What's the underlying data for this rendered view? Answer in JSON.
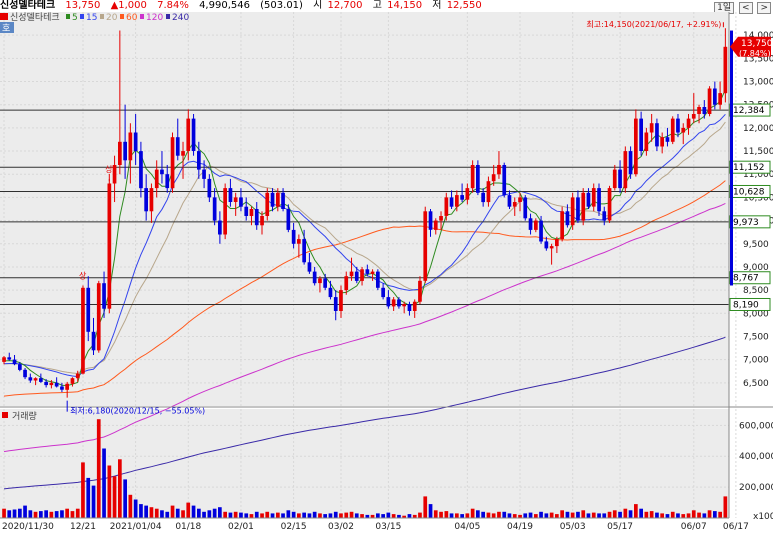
{
  "header": {
    "name": "신성델타테크",
    "price": "13,750",
    "change": "▲1,000",
    "rate": "7.84%",
    "volume": "4,990,546",
    "volume_paren": "(503.01)",
    "open_label": "시",
    "open": "12,700",
    "high_label": "고",
    "high": "14,150",
    "low_label": "저",
    "low": "12,550",
    "period_btn": "1일",
    "nav_prev": "<",
    "nav_next": ">"
  },
  "colors": {
    "up": "#e60000",
    "down": "#0000dd",
    "ma5": "#2e8b20",
    "ma15": "#3344ee",
    "ma20": "#b8a78c",
    "ma60": "#ff5a1e",
    "ma120": "#cc33cc",
    "ma240": "#3a2aa8",
    "grid": "#d8d8d8",
    "hline": "#303030"
  },
  "chart_data": {
    "type": "candlestick",
    "legend": {
      "name": "신성델타테크",
      "items": [
        "5",
        "15",
        "20",
        "60",
        "120",
        "240"
      ],
      "tag": "호"
    },
    "price_axis": {
      "min": 6000,
      "max": 14500,
      "ticks": [
        "14,000",
        "13,500",
        "13,000",
        "12,500",
        "12,000",
        "11,500",
        "11,000",
        "10,500",
        "10,000",
        "9,500",
        "9,000",
        "8,500",
        "8,000",
        "7,500",
        "7,000",
        "6,500"
      ]
    },
    "volume_axis": {
      "max": 680000,
      "ticks": [
        "600,000",
        "400,000",
        "200,000",
        "x100"
      ]
    },
    "volume_label": "거래량",
    "x_labels": [
      {
        "label": "2020/11/30",
        "i": 0
      },
      {
        "label": "12/21",
        "i": 15
      },
      {
        "label": "2021/01/04",
        "i": 25
      },
      {
        "label": "01/18",
        "i": 35
      },
      {
        "label": "02/01",
        "i": 45
      },
      {
        "label": "02/15",
        "i": 55
      },
      {
        "label": "03/02",
        "i": 64
      },
      {
        "label": "03/15",
        "i": 73
      },
      {
        "label": "04/05",
        "i": 88
      },
      {
        "label": "04/19",
        "i": 98
      },
      {
        "label": "05/03",
        "i": 108
      },
      {
        "label": "05/17",
        "i": 117
      },
      {
        "label": "06/07",
        "i": 131
      },
      {
        "label": "06/17",
        "i": 139
      }
    ],
    "support_lines": [
      "12,384",
      "11,152",
      "10,628",
      "9,973",
      "8,767",
      "8,190"
    ],
    "current_price": {
      "price": "13,750",
      "rate": "(7.84%)"
    },
    "annotations": {
      "high": "최고:14,150(2021/06/17, +2.91%)",
      "low": "최저:6,180(2020/12/15, −55.05%)",
      "marker_upper": "상",
      "marker_lower": "상"
    },
    "candles": [
      [
        6950,
        7080,
        6900,
        7050,
        60000
      ],
      [
        7050,
        7150,
        6980,
        7000,
        50000
      ],
      [
        7000,
        7100,
        6880,
        6900,
        55000
      ],
      [
        6900,
        6950,
        6750,
        6780,
        60000
      ],
      [
        6780,
        6820,
        6580,
        6620,
        80000
      ],
      [
        6620,
        6700,
        6500,
        6550,
        50000
      ],
      [
        6550,
        6620,
        6450,
        6600,
        40000
      ],
      [
        6600,
        6700,
        6500,
        6520,
        45000
      ],
      [
        6520,
        6580,
        6400,
        6450,
        50000
      ],
      [
        6450,
        6560,
        6380,
        6500,
        40000
      ],
      [
        6500,
        6620,
        6400,
        6420,
        45000
      ],
      [
        6420,
        6500,
        6300,
        6350,
        50000
      ],
      [
        6350,
        6520,
        6180,
        6480,
        60000
      ],
      [
        6480,
        6620,
        6420,
        6600,
        45000
      ],
      [
        6600,
        6760,
        6520,
        6700,
        60000
      ],
      [
        6700,
        8600,
        6680,
        8550,
        360000
      ],
      [
        8550,
        8800,
        7400,
        7600,
        260000
      ],
      [
        7600,
        7900,
        7100,
        7200,
        210000
      ],
      [
        7200,
        8700,
        7150,
        8650,
        640000
      ],
      [
        8650,
        8900,
        7900,
        8100,
        450000
      ],
      [
        8100,
        10900,
        8000,
        10800,
        340000
      ],
      [
        10800,
        11400,
        10400,
        11200,
        270000
      ],
      [
        11200,
        14100,
        11000,
        11700,
        380000
      ],
      [
        11700,
        12500,
        10900,
        11300,
        250000
      ],
      [
        11300,
        12100,
        10800,
        11900,
        150000
      ],
      [
        11900,
        12300,
        11200,
        11500,
        120000
      ],
      [
        11500,
        11700,
        10500,
        10700,
        90000
      ],
      [
        10700,
        11000,
        10000,
        10200,
        80000
      ],
      [
        10200,
        10800,
        9950,
        10700,
        70000
      ],
      [
        10700,
        11300,
        10500,
        11100,
        60000
      ],
      [
        11100,
        11500,
        10800,
        11000,
        50000
      ],
      [
        11000,
        11200,
        10600,
        10700,
        40000
      ],
      [
        10700,
        11900,
        10600,
        11800,
        80000
      ],
      [
        11800,
        12200,
        11300,
        11400,
        60000
      ],
      [
        11400,
        11700,
        10900,
        11500,
        50000
      ],
      [
        11500,
        12400,
        11300,
        12200,
        100000
      ],
      [
        12200,
        12300,
        11400,
        11500,
        80000
      ],
      [
        11500,
        11700,
        10900,
        11100,
        60000
      ],
      [
        11100,
        11300,
        10700,
        10900,
        40000
      ],
      [
        10900,
        11000,
        10400,
        10500,
        50000
      ],
      [
        10500,
        10700,
        9900,
        10000,
        60000
      ],
      [
        10000,
        10200,
        9500,
        9700,
        70000
      ],
      [
        9700,
        10800,
        9600,
        10700,
        40000
      ],
      [
        10700,
        10900,
        10300,
        10400,
        35000
      ],
      [
        10400,
        10600,
        10100,
        10500,
        40000
      ],
      [
        10500,
        10700,
        10200,
        10300,
        35000
      ],
      [
        10300,
        10500,
        10000,
        10100,
        30000
      ],
      [
        10100,
        10300,
        9900,
        10250,
        25000
      ],
      [
        10250,
        10400,
        9800,
        9900,
        40000
      ],
      [
        9900,
        10200,
        9700,
        10100,
        30000
      ],
      [
        10100,
        10700,
        10000,
        10600,
        40000
      ],
      [
        10600,
        10700,
        10200,
        10300,
        30000
      ],
      [
        10300,
        10700,
        10200,
        10600,
        35000
      ],
      [
        10600,
        10700,
        10200,
        10250,
        30000
      ],
      [
        10250,
        10350,
        9750,
        9800,
        50000
      ],
      [
        9800,
        9950,
        9400,
        9500,
        40000
      ],
      [
        9500,
        9700,
        9200,
        9600,
        30000
      ],
      [
        9600,
        9800,
        9050,
        9100,
        35000
      ],
      [
        9100,
        9300,
        8850,
        8900,
        30000
      ],
      [
        8900,
        9000,
        8600,
        8650,
        40000
      ],
      [
        8650,
        8800,
        8450,
        8750,
        30000
      ],
      [
        8750,
        8850,
        8500,
        8550,
        25000
      ],
      [
        8550,
        8700,
        8300,
        8350,
        30000
      ],
      [
        8350,
        8500,
        7850,
        8050,
        40000
      ],
      [
        8050,
        8600,
        7900,
        8500,
        30000
      ],
      [
        8500,
        8900,
        8400,
        8800,
        35000
      ],
      [
        8800,
        9200,
        8700,
        8900,
        40000
      ],
      [
        8900,
        9000,
        8650,
        8700,
        30000
      ],
      [
        8700,
        9000,
        8600,
        8950,
        25000
      ],
      [
        8950,
        9050,
        8800,
        8850,
        20000
      ],
      [
        8850,
        8950,
        8700,
        8900,
        20000
      ],
      [
        8900,
        8950,
        8500,
        8550,
        30000
      ],
      [
        8550,
        8650,
        8300,
        8350,
        25000
      ],
      [
        8350,
        8500,
        8100,
        8150,
        35000
      ],
      [
        8150,
        8350,
        8050,
        8300,
        25000
      ],
      [
        8300,
        8350,
        8100,
        8150,
        20000
      ],
      [
        8150,
        8250,
        8000,
        8200,
        15000
      ],
      [
        8200,
        8250,
        7950,
        8050,
        25000
      ],
      [
        8050,
        8300,
        7900,
        8250,
        20000
      ],
      [
        8250,
        8800,
        8200,
        8700,
        35000
      ],
      [
        8700,
        10300,
        8650,
        10200,
        140000
      ],
      [
        10200,
        10250,
        9650,
        9800,
        90000
      ],
      [
        9800,
        10050,
        9700,
        10000,
        50000
      ],
      [
        10000,
        10200,
        9800,
        10100,
        40000
      ],
      [
        10100,
        10600,
        10000,
        10500,
        45000
      ],
      [
        10500,
        10650,
        10250,
        10300,
        30000
      ],
      [
        10300,
        10650,
        10200,
        10550,
        30000
      ],
      [
        10550,
        10800,
        10400,
        10450,
        25000
      ],
      [
        10450,
        10800,
        10350,
        10700,
        30000
      ],
      [
        10700,
        11300,
        10600,
        11200,
        60000
      ],
      [
        11200,
        11300,
        10550,
        10600,
        50000
      ],
      [
        10600,
        10700,
        10300,
        10400,
        40000
      ],
      [
        10400,
        10950,
        10300,
        10850,
        35000
      ],
      [
        10850,
        11200,
        10750,
        11000,
        30000
      ],
      [
        11000,
        11500,
        10900,
        11200,
        40000
      ],
      [
        11200,
        11250,
        10500,
        10550,
        40000
      ],
      [
        10550,
        10650,
        10250,
        10300,
        30000
      ],
      [
        10300,
        10500,
        10100,
        10400,
        25000
      ],
      [
        10400,
        10600,
        10200,
        10500,
        20000
      ],
      [
        10500,
        10550,
        10000,
        10050,
        30000
      ],
      [
        10050,
        10150,
        9700,
        9800,
        35000
      ],
      [
        9800,
        10050,
        9750,
        10000,
        25000
      ],
      [
        10000,
        10100,
        9500,
        9550,
        40000
      ],
      [
        9550,
        9650,
        9350,
        9400,
        30000
      ],
      [
        9400,
        9500,
        9050,
        9450,
        35000
      ],
      [
        9450,
        9650,
        9300,
        9600,
        25000
      ],
      [
        9600,
        10300,
        9550,
        10200,
        50000
      ],
      [
        10200,
        10350,
        9850,
        9900,
        40000
      ],
      [
        9900,
        10600,
        9800,
        10500,
        35000
      ],
      [
        10500,
        10650,
        9950,
        10000,
        40000
      ],
      [
        10000,
        10700,
        9900,
        10600,
        50000
      ],
      [
        10600,
        10700,
        10250,
        10300,
        30000
      ],
      [
        10300,
        10800,
        10200,
        10700,
        35000
      ],
      [
        10700,
        10800,
        10100,
        10200,
        30000
      ],
      [
        10200,
        10300,
        9900,
        10000,
        30000
      ],
      [
        10000,
        10750,
        9950,
        10700,
        40000
      ],
      [
        10700,
        11200,
        10650,
        11100,
        50000
      ],
      [
        11100,
        11300,
        10600,
        10700,
        40000
      ],
      [
        10700,
        11600,
        10600,
        11500,
        60000
      ],
      [
        11500,
        11600,
        10900,
        11000,
        50000
      ],
      [
        11000,
        12400,
        10950,
        12200,
        90000
      ],
      [
        12200,
        12350,
        11400,
        11500,
        60000
      ],
      [
        11500,
        12000,
        11400,
        11900,
        40000
      ],
      [
        11900,
        12300,
        11700,
        12100,
        45000
      ],
      [
        12100,
        12200,
        11500,
        11600,
        35000
      ],
      [
        11600,
        11900,
        11450,
        11800,
        30000
      ],
      [
        11800,
        12000,
        11600,
        11700,
        25000
      ],
      [
        11700,
        12250,
        11650,
        12200,
        40000
      ],
      [
        12200,
        12300,
        11800,
        11900,
        30000
      ],
      [
        11900,
        12100,
        11650,
        12000,
        25000
      ],
      [
        12000,
        12300,
        11850,
        12200,
        30000
      ],
      [
        12200,
        12750,
        12100,
        12300,
        50000
      ],
      [
        12300,
        12500,
        12100,
        12450,
        35000
      ],
      [
        12450,
        12600,
        12200,
        12300,
        30000
      ],
      [
        12300,
        12900,
        12250,
        12850,
        50000
      ],
      [
        12850,
        13000,
        12400,
        12500,
        45000
      ],
      [
        12500,
        13000,
        12400,
        12750,
        40000
      ],
      [
        12750,
        14150,
        12550,
        13750,
        140000
      ]
    ]
  }
}
